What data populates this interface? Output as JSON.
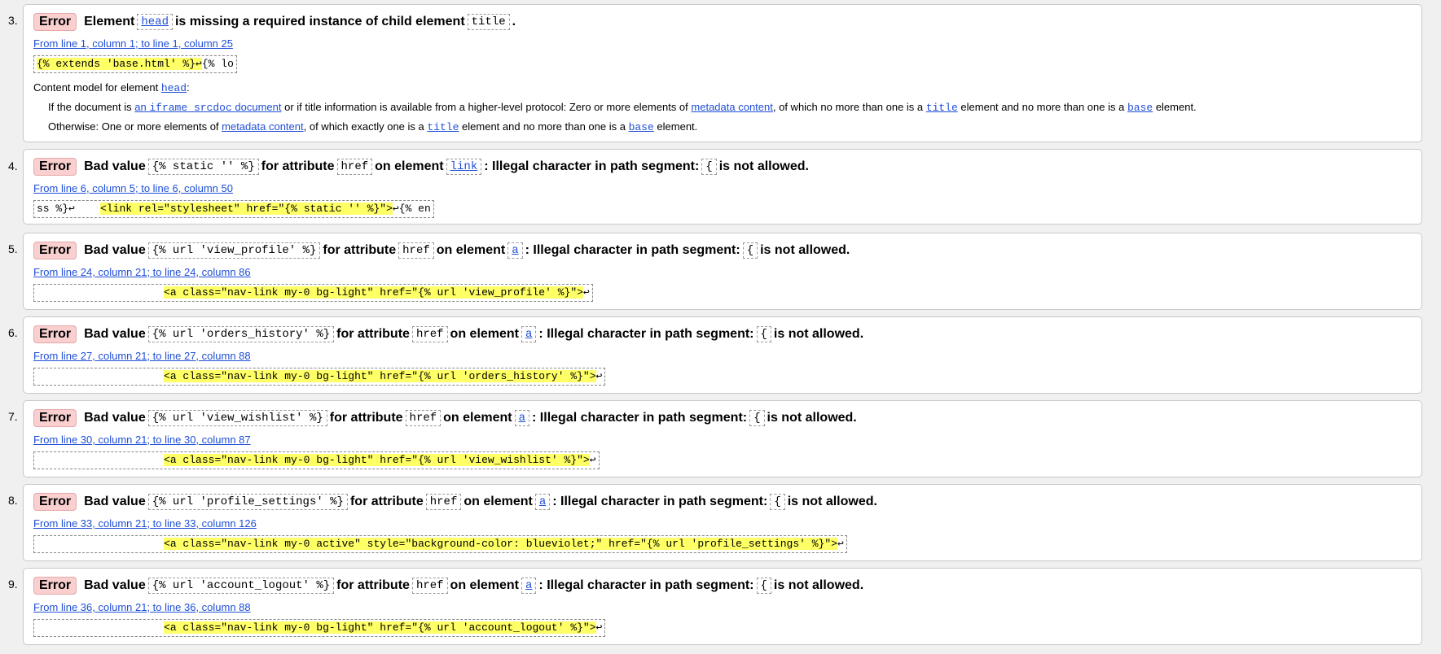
{
  "errors": [
    {
      "number": "3.",
      "badge": "Error",
      "message_parts": [
        "Element",
        "head",
        "is missing a required instance of child element",
        "title",
        "."
      ],
      "location": "From line 1, column 1; to line 1, column 25",
      "extract_hl": "{% extends 'base.html' %}↩",
      "extract_tail": "{% lo",
      "content_model": {
        "label": "Content model for element",
        "element": "head",
        "colon": ":",
        "line1_a": "If the document is",
        "line1_link1_a": "an",
        "line1_link1_code": "iframe srcdoc",
        "line1_link1_b": "document",
        "line1_b": "or if title information is available from a higher-level protocol: Zero or more elements of",
        "line1_link2": "metadata content",
        "line1_c": ", of which no more than one is a",
        "line1_code1": "title",
        "line1_d": "element and no more than one is a",
        "line1_code2": "base",
        "line1_e": "element.",
        "line2_a": "Otherwise: One or more elements of",
        "line2_link": "metadata content",
        "line2_b": ", of which exactly one is a",
        "line2_code1": "title",
        "line2_c": "element and no more than one is a",
        "line2_code2": "base",
        "line2_d": "element."
      }
    },
    {
      "number": "4.",
      "badge": "Error",
      "bad_value_label": "Bad value",
      "value": "{% static '' %}",
      "for_attr": "for attribute",
      "attribute": "href",
      "on_element": "on element",
      "element": "link",
      "illegal": ": Illegal character in path segment:",
      "char": "{",
      "not_allowed": "is not allowed.",
      "location": "From line 6, column 5; to line 6, column 50",
      "extract_pre": "ss %}↩    ",
      "extract_hl": "<link rel=\"stylesheet\" href=\"{% static '' %}\">",
      "extract_tail": "↩{% en"
    },
    {
      "number": "5.",
      "badge": "Error",
      "bad_value_label": "Bad value",
      "value": "{% url 'view_profile' %}",
      "for_attr": "for attribute",
      "attribute": "href",
      "on_element": "on element",
      "element": "a",
      "illegal": ": Illegal character in path segment:",
      "char": "{",
      "not_allowed": "is not allowed.",
      "location": "From line 24, column 21; to line 24, column 86",
      "extract_pre": "                    ",
      "extract_hl": "<a class=\"nav-link my-0 bg-light\" href=\"{% url 'view_profile' %}\">",
      "extract_tail": "↩"
    },
    {
      "number": "6.",
      "badge": "Error",
      "bad_value_label": "Bad value",
      "value": "{% url 'orders_history' %}",
      "for_attr": "for attribute",
      "attribute": "href",
      "on_element": "on element",
      "element": "a",
      "illegal": ": Illegal character in path segment:",
      "char": "{",
      "not_allowed": "is not allowed.",
      "location": "From line 27, column 21; to line 27, column 88",
      "extract_pre": "                    ",
      "extract_hl": "<a class=\"nav-link my-0 bg-light\" href=\"{% url 'orders_history' %}\">",
      "extract_tail": "↩"
    },
    {
      "number": "7.",
      "badge": "Error",
      "bad_value_label": "Bad value",
      "value": "{% url 'view_wishlist' %}",
      "for_attr": "for attribute",
      "attribute": "href",
      "on_element": "on element",
      "element": "a",
      "illegal": ": Illegal character in path segment:",
      "char": "{",
      "not_allowed": "is not allowed.",
      "location": "From line 30, column 21; to line 30, column 87",
      "extract_pre": "                    ",
      "extract_hl": "<a class=\"nav-link my-0 bg-light\" href=\"{% url 'view_wishlist' %}\">",
      "extract_tail": "↩"
    },
    {
      "number": "8.",
      "badge": "Error",
      "bad_value_label": "Bad value",
      "value": "{% url 'profile_settings' %}",
      "for_attr": "for attribute",
      "attribute": "href",
      "on_element": "on element",
      "element": "a",
      "illegal": ": Illegal character in path segment:",
      "char": "{",
      "not_allowed": "is not allowed.",
      "location": "From line 33, column 21; to line 33, column 126",
      "extract_pre": "                    ",
      "extract_hl": "<a class=\"nav-link my-0 active\" style=\"background-color: blueviolet;\" href=\"{% url 'profile_settings' %}\">",
      "extract_tail": "↩"
    },
    {
      "number": "9.",
      "badge": "Error",
      "bad_value_label": "Bad value",
      "value": "{% url 'account_logout' %}",
      "for_attr": "for attribute",
      "attribute": "href",
      "on_element": "on element",
      "element": "a",
      "illegal": ": Illegal character in path segment:",
      "char": "{",
      "not_allowed": "is not allowed.",
      "location": "From line 36, column 21; to line 36, column 88",
      "extract_pre": "                    ",
      "extract_hl": "<a class=\"nav-link my-0 bg-light\" href=\"{% url 'account_logout' %}\">",
      "extract_tail": "↩"
    }
  ],
  "colors": {
    "badge_bg": "#f9cfcf",
    "link": "#1f4fd6",
    "highlight": "#ffff66",
    "page_bg": "#f0f0f0"
  }
}
